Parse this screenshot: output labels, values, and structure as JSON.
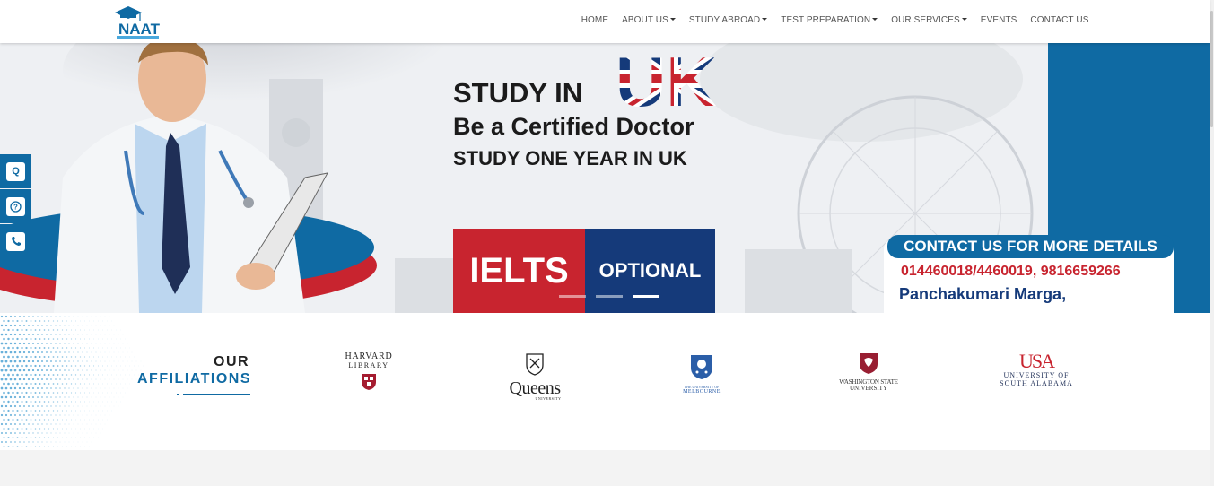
{
  "navbar": {
    "logo_text": "NAAT",
    "items": [
      {
        "label": "HOME",
        "dropdown": false
      },
      {
        "label": "ABOUT US",
        "dropdown": true
      },
      {
        "label": "STUDY ABROAD",
        "dropdown": true
      },
      {
        "label": "TEST PREPARATION",
        "dropdown": true
      },
      {
        "label": "OUR SERVICES",
        "dropdown": true
      },
      {
        "label": "EVENTS",
        "dropdown": false
      },
      {
        "label": "CONTACT US",
        "dropdown": false
      }
    ]
  },
  "hero": {
    "line1": "STUDY IN",
    "line1_flag": "UK",
    "line2": "Be a Certified Doctor",
    "line3": "STUDY ONE YEAR IN UK",
    "ielts": "IELTS",
    "optional": "OPTIONAL",
    "contact_title": "CONTACT US FOR MORE DETAILS",
    "contact_phone": "014460018/4460019, 9816659266",
    "contact_address": "Panchakumari Marga,",
    "slide_count": 3,
    "active_slide": 3
  },
  "side_tools": [
    {
      "icon": "q-icon",
      "glyph": "Q"
    },
    {
      "icon": "help-circle-icon",
      "glyph": "?"
    },
    {
      "icon": "phone-icon",
      "glyph": "✆"
    }
  ],
  "affiliations": {
    "heading_top": "OUR",
    "heading_bottom": "AFFILIATIONS",
    "universities": [
      {
        "name_lines": [
          "HARVARD",
          "LIBRARY"
        ]
      },
      {
        "name_lines": [
          "Queens",
          "UNIVERSITY"
        ]
      },
      {
        "name_lines": [
          "THE UNIVERSITY OF",
          "MELBOURNE"
        ]
      },
      {
        "name_lines": [
          "WASHINGTON STATE",
          "UNIVERSITY"
        ]
      },
      {
        "name_lines": [
          "USA",
          "UNIVERSITY OF",
          "SOUTH ALABAMA"
        ]
      }
    ]
  },
  "colors": {
    "brand_blue": "#0f6aa3",
    "brand_red": "#c8242f",
    "navy": "#153a7a"
  }
}
